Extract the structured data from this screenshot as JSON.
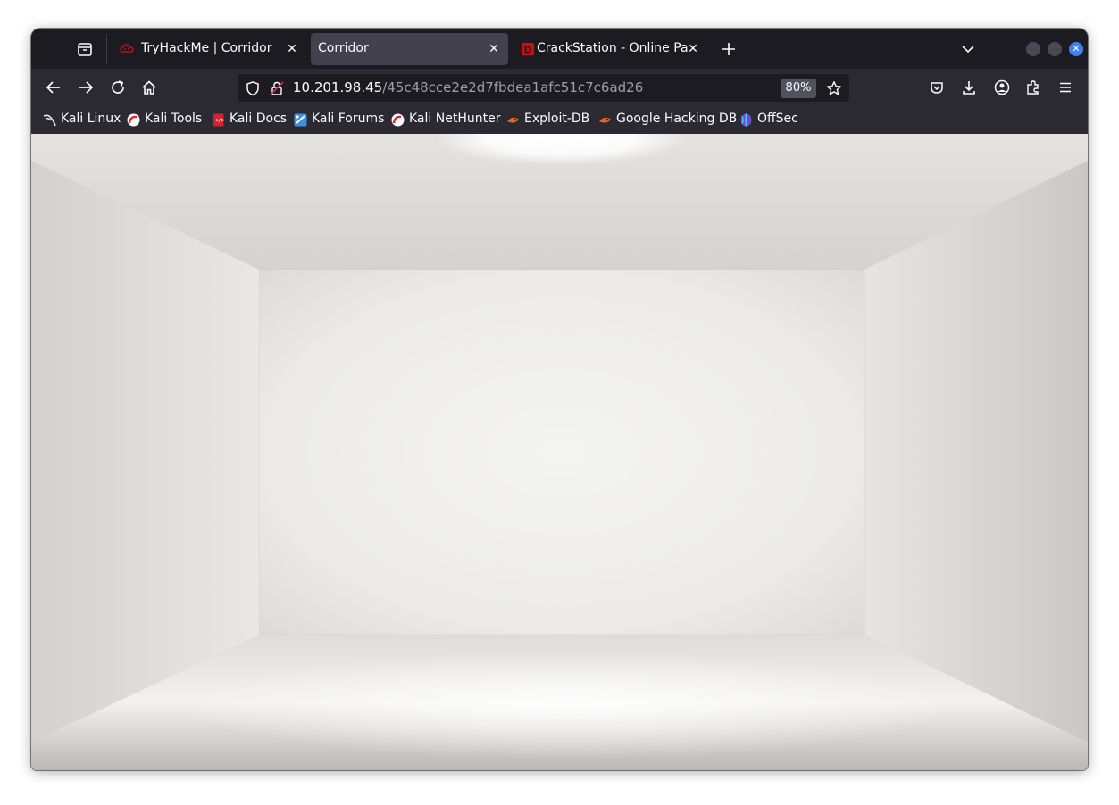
{
  "tabs": [
    {
      "title": "TryHackMe | Corridor",
      "favicon": "tryhackme-icon",
      "active": false
    },
    {
      "title": "Corridor",
      "favicon": "none",
      "active": true
    },
    {
      "title": "CrackStation - Online Pas",
      "favicon": "crackstation-icon",
      "active": false
    }
  ],
  "urlbar": {
    "host": "10.201.98.45",
    "path": "/45c48cce2e2d7fbdea1afc51c7c6ad26",
    "zoom": "80%"
  },
  "bookmarks": [
    {
      "label": "Kali Linux",
      "icon": "kali-dragon-icon"
    },
    {
      "label": "Kali Tools",
      "icon": "kali-tools-icon"
    },
    {
      "label": "Kali Docs",
      "icon": "kali-docs-icon"
    },
    {
      "label": "Kali Forums",
      "icon": "kali-forums-icon"
    },
    {
      "label": "Kali NetHunter",
      "icon": "kali-nethunter-icon"
    },
    {
      "label": "Exploit-DB",
      "icon": "exploit-db-icon"
    },
    {
      "label": "Google Hacking DB",
      "icon": "ghdb-icon"
    },
    {
      "label": "OffSec",
      "icon": "offsec-icon"
    }
  ],
  "colors": {
    "window_bg": "#1c1b22",
    "toolbar_bg": "#2b2a33",
    "active_tab": "#42414d",
    "close_button": "#3b82f6",
    "room_wall": "#e8e7e4"
  }
}
